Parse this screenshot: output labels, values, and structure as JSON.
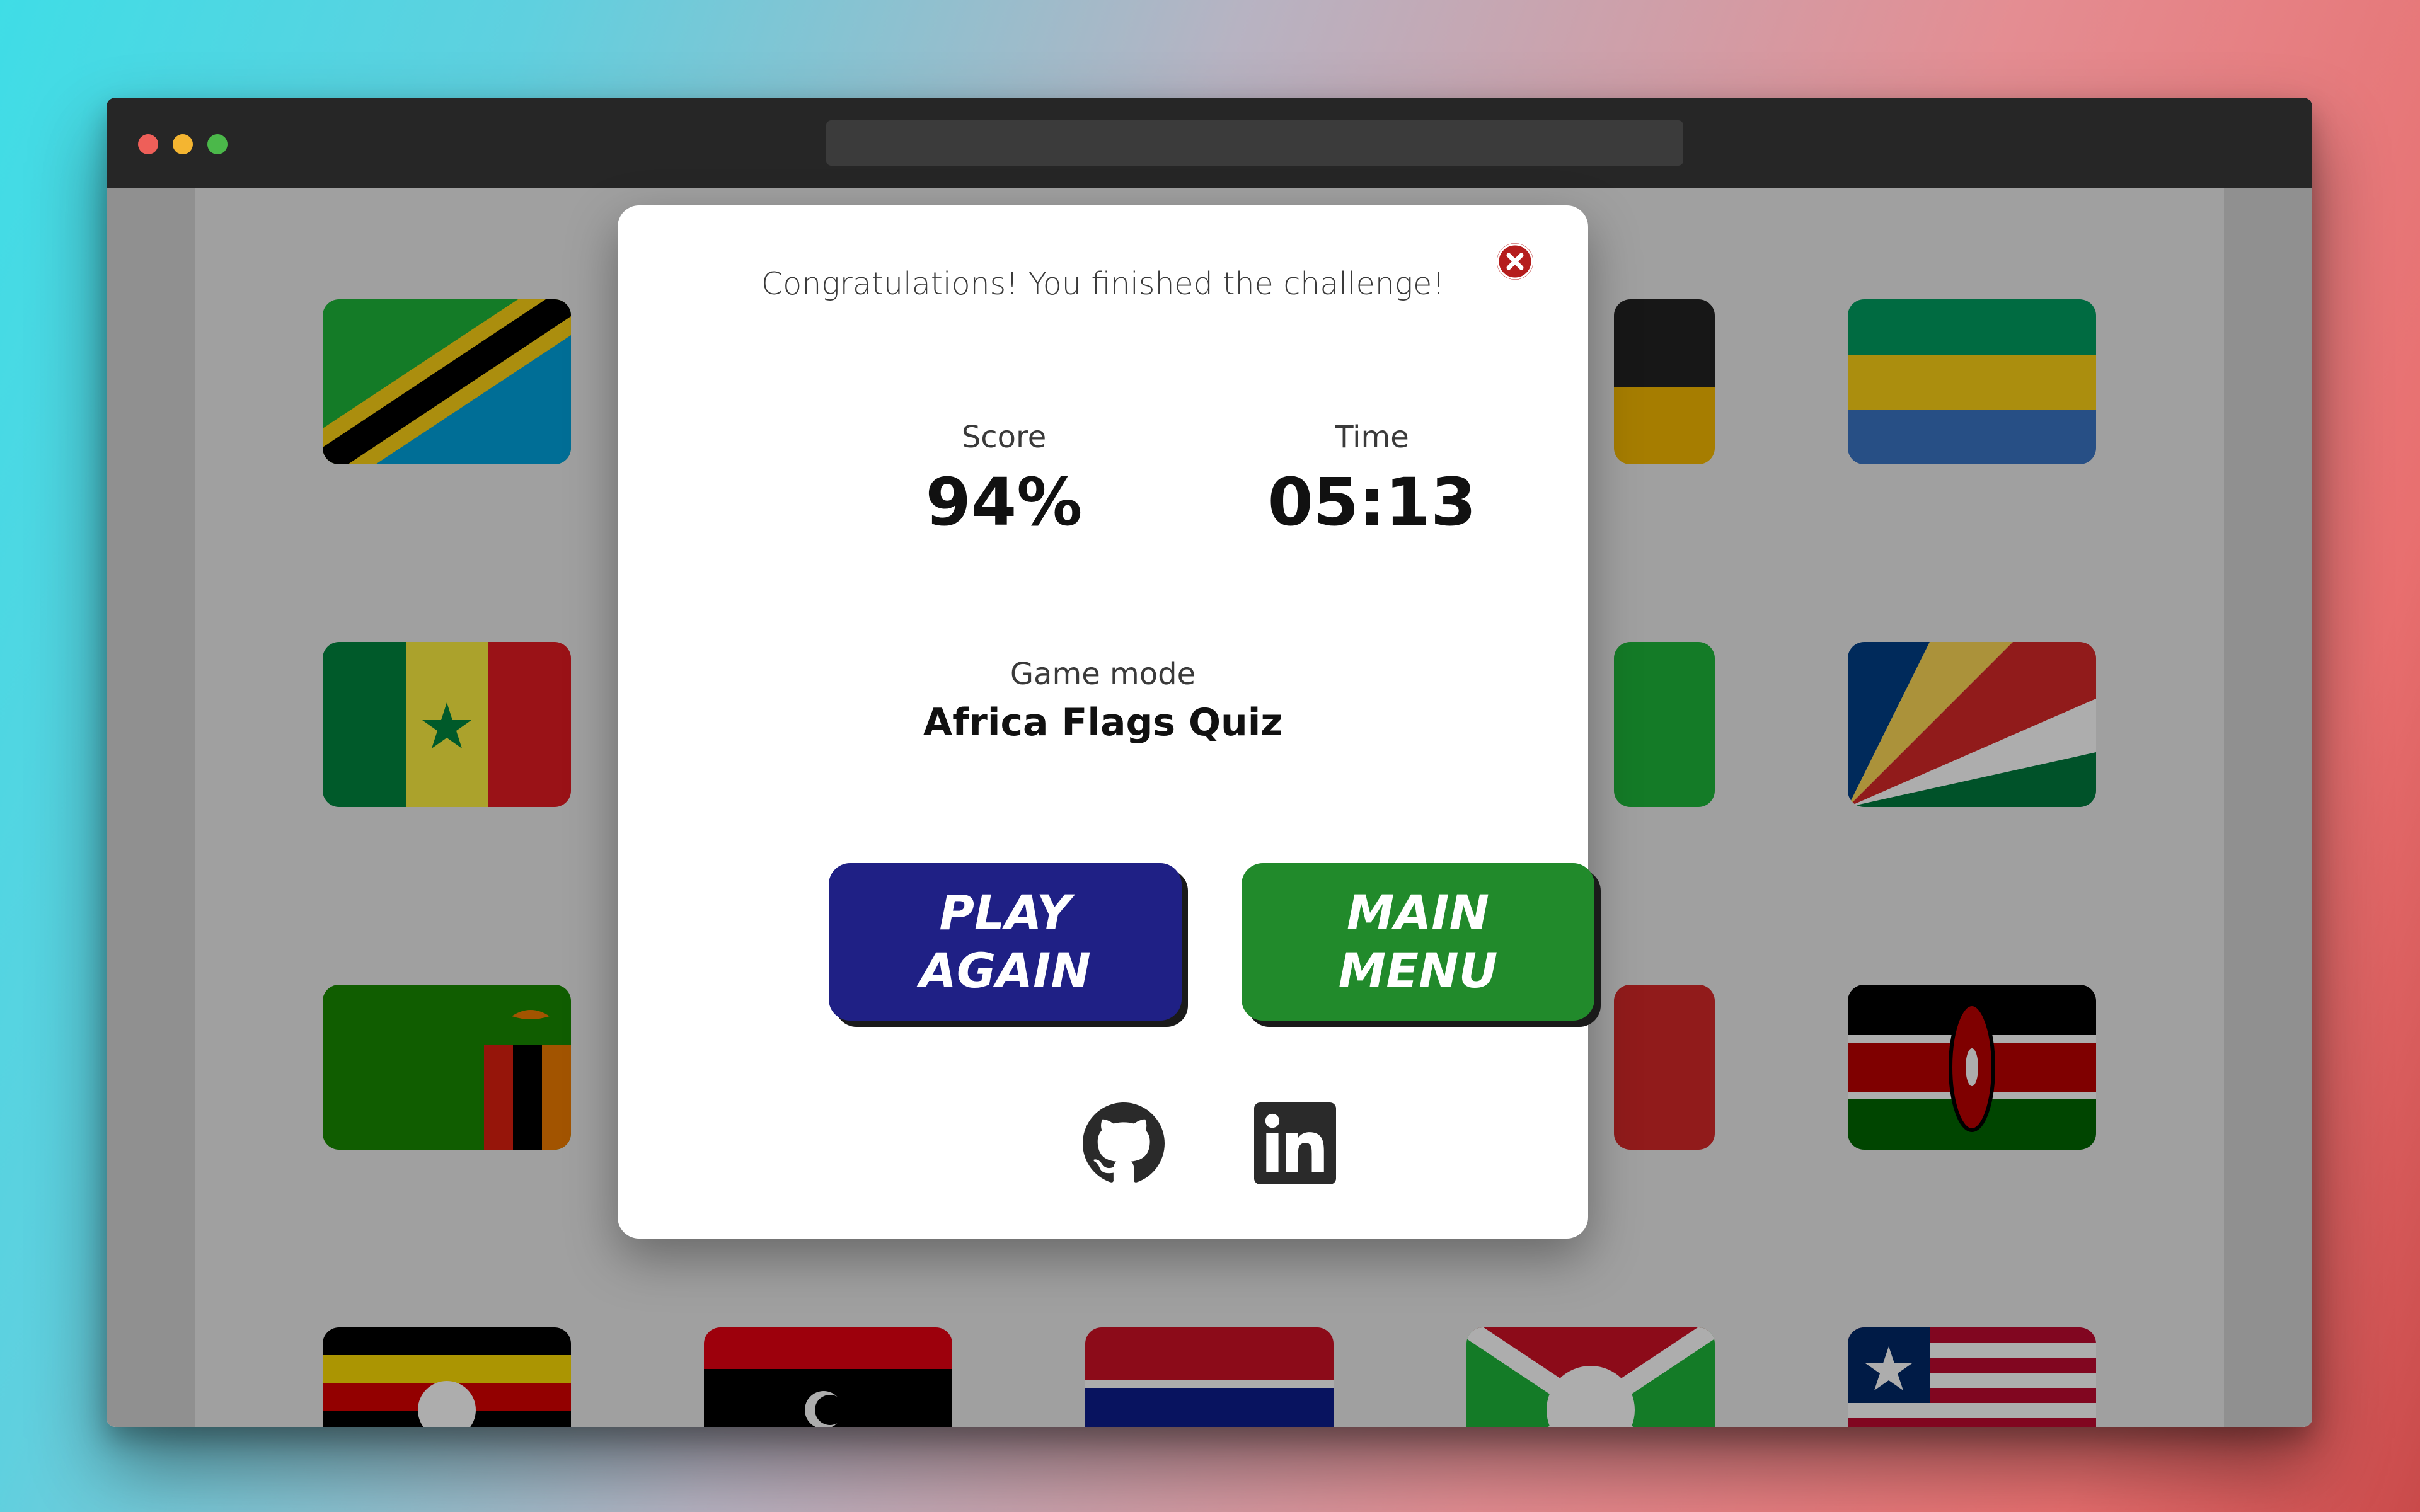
{
  "browser": {
    "traffic_lights": [
      "close",
      "minimize",
      "zoom"
    ],
    "colors": {
      "close": "#ee5f59",
      "minimize": "#f4b531",
      "zoom": "#4bb84a"
    }
  },
  "background_flags": [
    {
      "country": "Tanzania",
      "row": 1,
      "col": 1
    },
    {
      "country": "Gabon",
      "row": 1,
      "col": 5
    },
    {
      "country": "Senegal",
      "row": 2,
      "col": 1
    },
    {
      "country": "Seychelles",
      "row": 2,
      "col": 5
    },
    {
      "country": "Zambia",
      "row": 3,
      "col": 1
    },
    {
      "country": "Kenya",
      "row": 3,
      "col": 5
    },
    {
      "country": "Uganda",
      "row": 4,
      "col": 1
    },
    {
      "country": "Libya",
      "row": 4,
      "col": 2
    },
    {
      "country": "Gambia",
      "row": 4,
      "col": 3
    },
    {
      "country": "Burundi",
      "row": 4,
      "col": 4
    },
    {
      "country": "Liberia",
      "row": 4,
      "col": 5
    }
  ],
  "modal": {
    "message": "Congratulations! You finished the challenge!",
    "score_label": "Score",
    "score_value": "94%",
    "time_label": "Time",
    "time_value": "05:13",
    "mode_label": "Game mode",
    "mode_value": "Africa Flags Quiz",
    "play_again_line1": "PLAY",
    "play_again_line2": "AGAIN",
    "main_menu_line1": "MAIN",
    "main_menu_line2": "MENU",
    "social_icons": [
      "github-icon",
      "linkedin-icon"
    ],
    "colors": {
      "play_again": "#1f2085",
      "main_menu": "#218a2b",
      "close": "#b51d1d"
    }
  }
}
